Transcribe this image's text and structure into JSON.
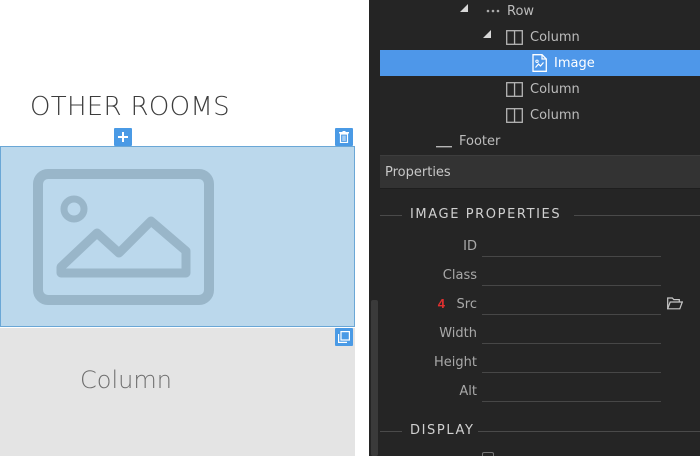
{
  "canvas": {
    "heading": "OTHER ROOMS",
    "column_label": "Column"
  },
  "tree": {
    "items": [
      {
        "label": "Row"
      },
      {
        "label": "Column"
      },
      {
        "label": "Image"
      },
      {
        "label": "Column"
      },
      {
        "label": "Column"
      },
      {
        "label": "Footer"
      }
    ]
  },
  "properties": {
    "header": "Properties",
    "image_group_title": "IMAGE PROPERTIES",
    "fields": [
      {
        "label": "ID",
        "value": ""
      },
      {
        "label": "Class",
        "value": ""
      },
      {
        "label": "Src",
        "value": "",
        "badge": "4"
      },
      {
        "label": "Width",
        "value": ""
      },
      {
        "label": "Height",
        "value": ""
      },
      {
        "label": "Alt",
        "value": ""
      }
    ],
    "display_group_title": "DISPLAY"
  },
  "colors": {
    "selection": "#4e97e9",
    "control_button": "#4a9ae5",
    "image_placeholder_fill": "#bbd8ec",
    "badge_red": "#e0302f"
  },
  "icons": {
    "image_placeholder": "image-icon",
    "add": "plus-icon",
    "delete": "trash-icon",
    "duplicate": "copy-icon",
    "row": "ellipsis-icon",
    "column": "column-icon",
    "image_node": "image-file-icon",
    "footer": "footer-icon",
    "browse": "folder-open-icon"
  }
}
